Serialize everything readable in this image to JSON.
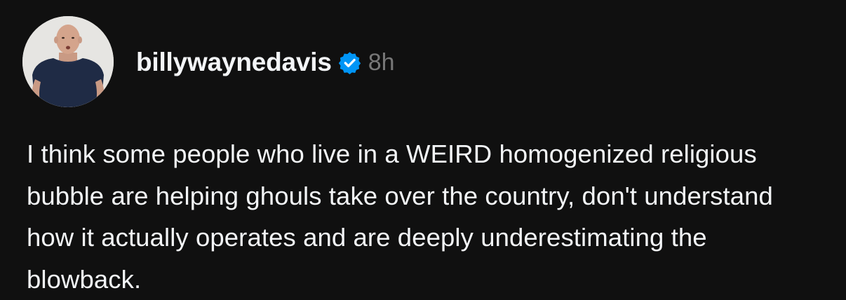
{
  "post": {
    "author": {
      "username": "billywaynedavis",
      "verified": true,
      "avatar_icon": "user-avatar"
    },
    "timestamp": "8h",
    "text": "I think some people who live in a WEIRD homogenized religious bubble are helping ghouls take over the country, don't understand how it actually operates and are deeply underestimating the blowback."
  },
  "colors": {
    "background": "#101010",
    "text_primary": "#f3f5f7",
    "text_secondary": "#777777",
    "verified_badge": "#0095f6"
  }
}
